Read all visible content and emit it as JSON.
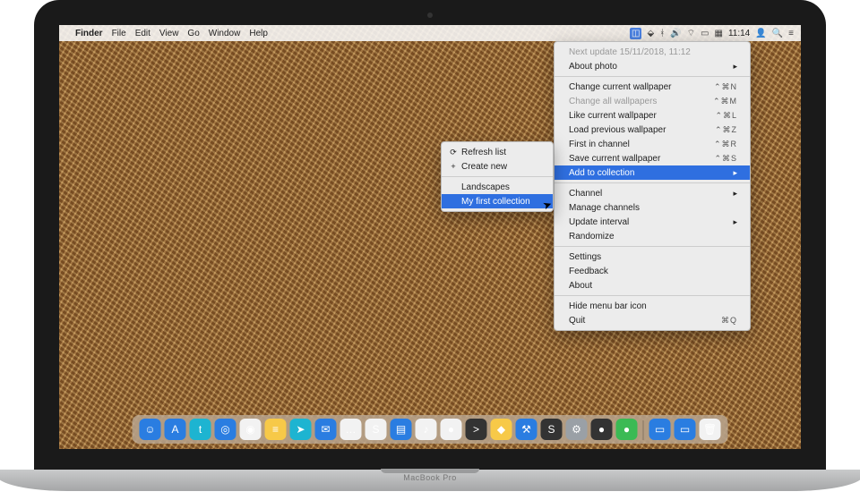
{
  "device_label": "MacBook Pro",
  "menubar": {
    "app_items": [
      "Finder",
      "File",
      "Edit",
      "View",
      "Go",
      "Window",
      "Help"
    ],
    "clock": "11:14"
  },
  "dropdown": {
    "next_update": "Next update 15/11/2018, 11:12",
    "about_photo": "About photo",
    "change_current": "Change current wallpaper",
    "change_all": "Change all wallpapers",
    "like": "Like current wallpaper",
    "load_prev": "Load previous wallpaper",
    "first_in_channel": "First in channel",
    "save": "Save current wallpaper",
    "add_to_collection": "Add to collection",
    "channel": "Channel",
    "manage_channels": "Manage channels",
    "update_interval": "Update interval",
    "randomize": "Randomize",
    "settings": "Settings",
    "feedback": "Feedback",
    "about": "About",
    "hide_icon": "Hide menu bar icon",
    "quit": "Quit",
    "shortcuts": {
      "change_current": "⌃⌘N",
      "change_all": "⌃⌘M",
      "like": "⌃⌘L",
      "load_prev": "⌃⌘Z",
      "first_in_channel": "⌃⌘R",
      "save": "⌃⌘S",
      "quit": "⌘Q"
    }
  },
  "submenu": {
    "refresh": "Refresh list",
    "create_new": "Create new",
    "landscapes": "Landscapes",
    "my_first": "My first collection"
  },
  "dock_items": [
    {
      "name": "finder-icon",
      "glyph": "☺",
      "cls": "c-blue"
    },
    {
      "name": "app-store-icon",
      "glyph": "A",
      "cls": "c-blue"
    },
    {
      "name": "twitter-icon",
      "glyph": "t",
      "cls": "c-teal"
    },
    {
      "name": "safari-icon",
      "glyph": "◎",
      "cls": "c-blue"
    },
    {
      "name": "chrome-icon",
      "glyph": "◉",
      "cls": "c-white"
    },
    {
      "name": "notes-icon",
      "glyph": "≡",
      "cls": "c-yellow"
    },
    {
      "name": "telegram-icon",
      "glyph": "➤",
      "cls": "c-teal"
    },
    {
      "name": "mail-icon",
      "glyph": "✉",
      "cls": "c-blue"
    },
    {
      "name": "messages-icon",
      "glyph": "…",
      "cls": "c-white"
    },
    {
      "name": "slack-icon",
      "glyph": "S",
      "cls": "c-white"
    },
    {
      "name": "trello-icon",
      "glyph": "▤",
      "cls": "c-blue"
    },
    {
      "name": "music-icon",
      "glyph": "♪",
      "cls": "c-white"
    },
    {
      "name": "app-generic-icon",
      "glyph": "●",
      "cls": "c-white"
    },
    {
      "name": "terminal-icon",
      "glyph": ">",
      "cls": "c-dark"
    },
    {
      "name": "sketch-icon",
      "glyph": "◆",
      "cls": "c-yellow"
    },
    {
      "name": "xcode-icon",
      "glyph": "⚒",
      "cls": "c-blue"
    },
    {
      "name": "sublime-icon",
      "glyph": "S",
      "cls": "c-dark"
    },
    {
      "name": "preferences-icon",
      "glyph": "⚙",
      "cls": "c-grey"
    },
    {
      "name": "app-misc-1-icon",
      "glyph": "●",
      "cls": "c-dark"
    },
    {
      "name": "app-misc-2-icon",
      "glyph": "●",
      "cls": "c-green"
    }
  ],
  "dock_right": [
    {
      "name": "downloads-folder-icon",
      "glyph": "▭",
      "cls": "c-blue"
    },
    {
      "name": "folder-icon",
      "glyph": "▭",
      "cls": "c-blue"
    },
    {
      "name": "trash-icon",
      "glyph": "🗑",
      "cls": "c-white"
    }
  ]
}
